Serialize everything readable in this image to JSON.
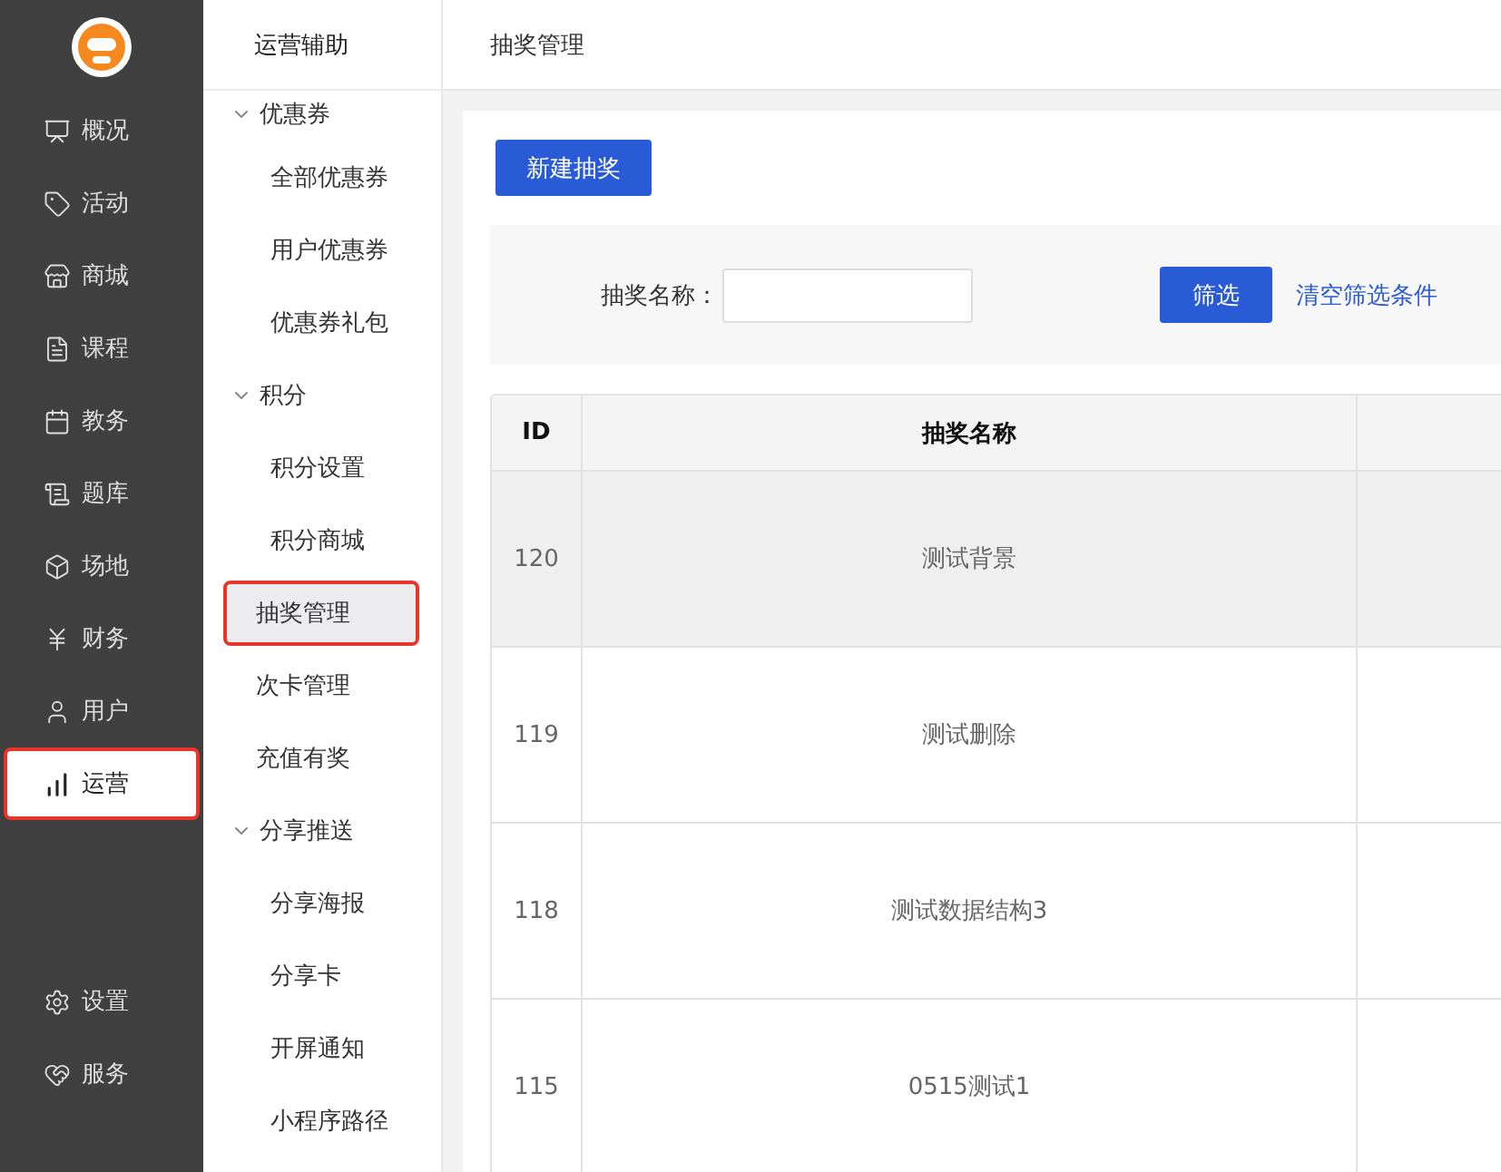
{
  "main_nav": {
    "items": [
      {
        "label": "概况",
        "selected": false
      },
      {
        "label": "活动",
        "selected": false
      },
      {
        "label": "商城",
        "selected": false
      },
      {
        "label": "课程",
        "selected": false
      },
      {
        "label": "教务",
        "selected": false
      },
      {
        "label": "题库",
        "selected": false
      },
      {
        "label": "场地",
        "selected": false
      },
      {
        "label": "财务",
        "selected": false
      },
      {
        "label": "用户",
        "selected": false
      },
      {
        "label": "运营",
        "selected": true
      }
    ],
    "bottom_items": [
      {
        "label": "设置",
        "selected": false
      },
      {
        "label": "服务",
        "selected": false
      }
    ]
  },
  "sub_nav": {
    "title": "运营辅助",
    "items": [
      {
        "label": "优惠券",
        "expanded": true,
        "selected": false,
        "children": [
          {
            "label": "全部优惠券",
            "selected": false
          },
          {
            "label": "用户优惠券",
            "selected": false
          },
          {
            "label": "优惠券礼包",
            "selected": false
          }
        ]
      },
      {
        "label": "积分",
        "expanded": true,
        "selected": false,
        "children": [
          {
            "label": "积分设置",
            "selected": false
          },
          {
            "label": "积分商城",
            "selected": false
          }
        ]
      },
      {
        "label": "抽奖管理",
        "selected": true
      },
      {
        "label": "次卡管理",
        "selected": false
      },
      {
        "label": "充值有奖",
        "selected": false
      },
      {
        "label": "分享推送",
        "expanded": true,
        "selected": false,
        "children": [
          {
            "label": "分享海报",
            "selected": false
          },
          {
            "label": "分享卡",
            "selected": false
          },
          {
            "label": "开屏通知",
            "selected": false
          },
          {
            "label": "小程序路径",
            "selected": false
          }
        ]
      }
    ]
  },
  "page": {
    "title": "抽奖管理",
    "new_button": "新建抽奖",
    "filter": {
      "label": "抽奖名称：",
      "filter_button": "筛选",
      "clear_link": "清空筛选条件"
    },
    "table": {
      "columns": [
        "ID",
        "抽奖名称"
      ],
      "rows": [
        {
          "id": "120",
          "name": "测试背景",
          "selected": true
        },
        {
          "id": "119",
          "name": "测试删除",
          "selected": false
        },
        {
          "id": "118",
          "name": "测试数据结构3",
          "selected": false
        },
        {
          "id": "115",
          "name": "0515测试1",
          "selected": false
        }
      ]
    }
  }
}
